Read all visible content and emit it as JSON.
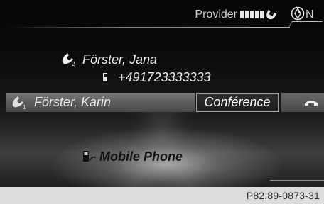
{
  "status_bar": {
    "provider_label": "Provider",
    "signal_bars": 5,
    "nav_letter": "N"
  },
  "active_call": {
    "caller_name": "Förster, Jana",
    "line_badge": "2",
    "number": "+491723333333"
  },
  "held_call": {
    "caller_name": "Förster, Karin",
    "line_badge": "1",
    "conference_label": "Conférence"
  },
  "device": {
    "label": "Mobile Phone"
  },
  "caption": {
    "reference": "P82.89-0873-31"
  },
  "colors": {
    "screen_bg": "#0b0b0b",
    "held_bar": "#5e5e5e",
    "text_light": "#f2f2f2",
    "caption_bg": "#dcdcdc"
  }
}
